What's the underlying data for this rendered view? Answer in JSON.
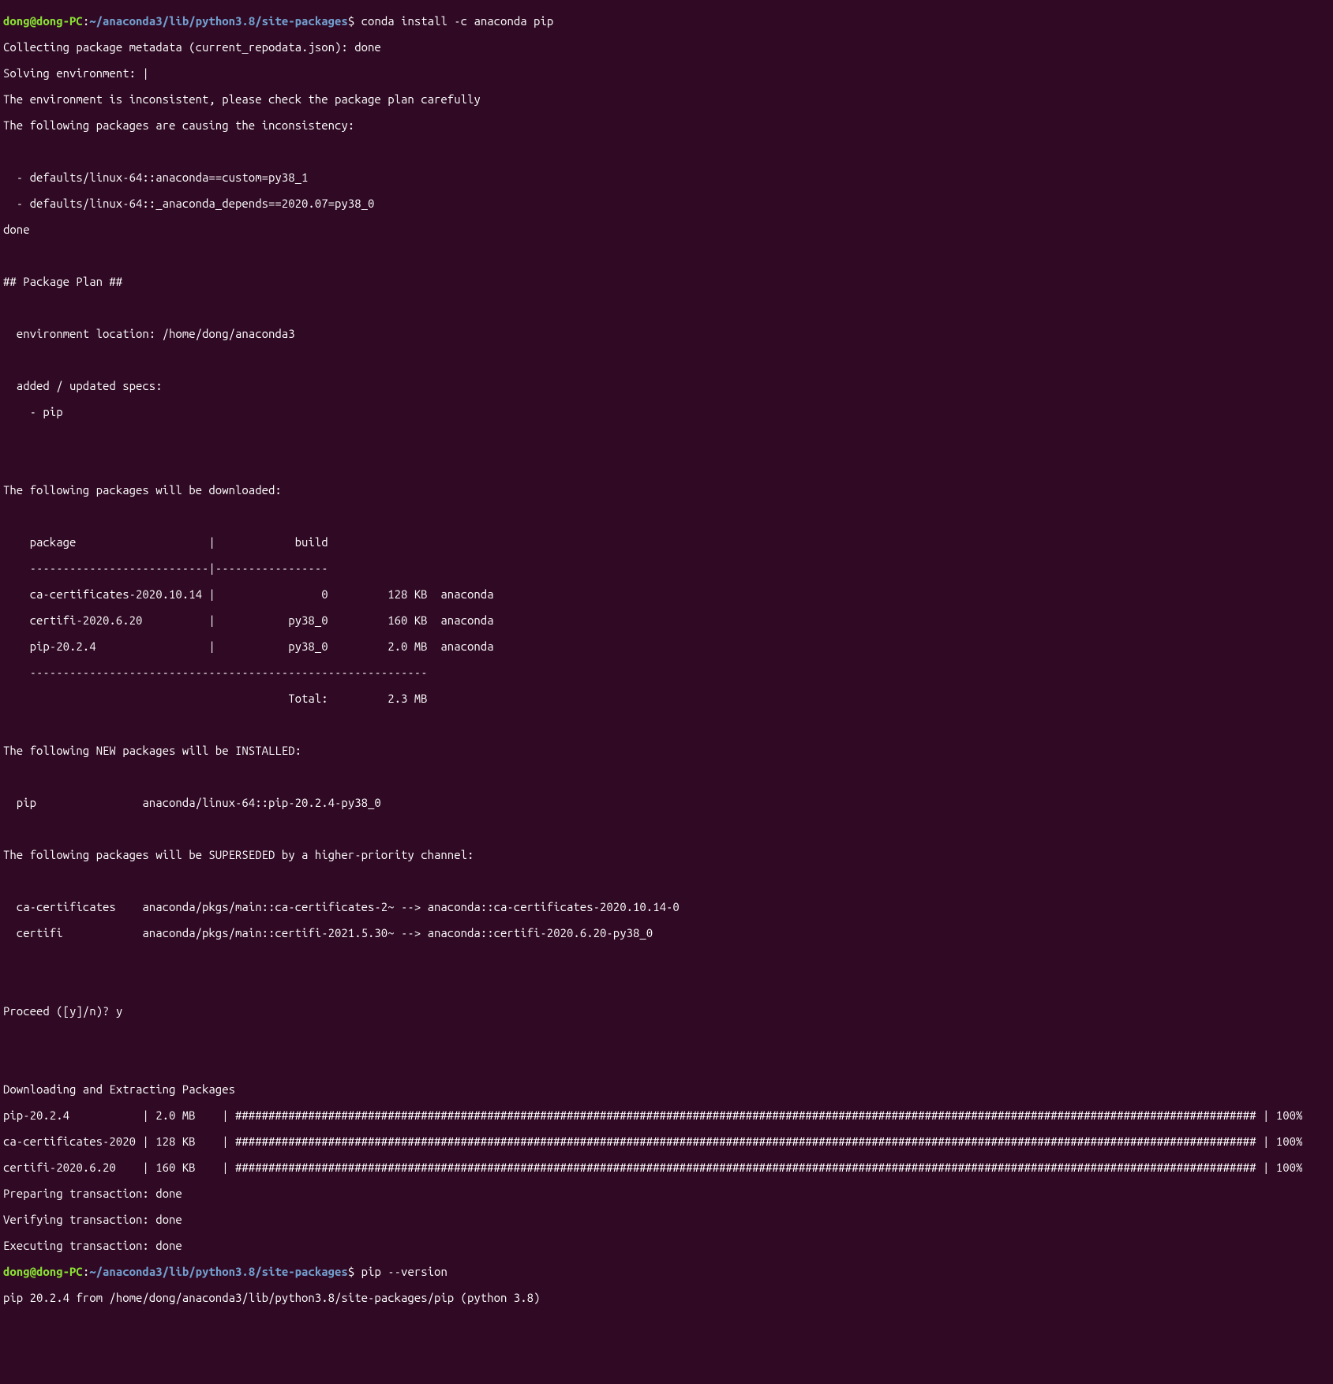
{
  "prompt1": {
    "user": "dong@dong-PC",
    "path": "~/anaconda3/lib/python3.8/site-packages",
    "command": "conda install -c anaconda pip"
  },
  "prompt2": {
    "user": "dong@dong-PC",
    "path": "~/anaconda3/lib/python3.8/site-packages",
    "command": "pip --version"
  },
  "output": {
    "collecting": "Collecting package metadata (current_repodata.json): done",
    "solving": "Solving environment: |",
    "inconsistent": "The environment is inconsistent, please check the package plan carefully",
    "causing": "The following packages are causing the inconsistency:",
    "inc1": "  - defaults/linux-64::anaconda==custom=py38_1",
    "inc2": "  - defaults/linux-64::_anaconda_depends==2020.07=py38_0",
    "done": "done",
    "planHeader": "## Package Plan ##",
    "envLoc": "  environment location: /home/dong/anaconda3",
    "addedSpecs": "  added / updated specs:",
    "specPip": "    - pip",
    "willDownload": "The following packages will be downloaded:",
    "tableHeader": "    package                    |            build",
    "tableDiv1": "    ---------------------------|-----------------",
    "tableRow1": "    ca-certificates-2020.10.14 |                0         128 KB  anaconda",
    "tableRow2": "    certifi-2020.6.20          |           py38_0         160 KB  anaconda",
    "tableRow3": "    pip-20.2.4                 |           py38_0         2.0 MB  anaconda",
    "tableDiv2": "    ------------------------------------------------------------",
    "tableTotal": "                                           Total:         2.3 MB",
    "newInstalled": "The following NEW packages will be INSTALLED:",
    "newPip": "  pip                anaconda/linux-64::pip-20.2.4-py38_0",
    "superseded": "The following packages will be SUPERSEDED by a higher-priority channel:",
    "sup1": "  ca-certificates    anaconda/pkgs/main::ca-certificates-2~ --> anaconda::ca-certificates-2020.10.14-0",
    "sup2": "  certifi            anaconda/pkgs/main::certifi-2021.5.30~ --> anaconda::certifi-2020.6.20-py38_0",
    "proceed": "Proceed ([y]/n)?",
    "proceedAns": "y",
    "downloadHeader": "Downloading and Extracting Packages",
    "prog1": "pip-20.2.4           | 2.0 MB    | ########################################################################################################################################################## | 100%",
    "prog2": "ca-certificates-2020 | 128 KB    | ########################################################################################################################################################## | 100%",
    "prog3": "certifi-2020.6.20    | 160 KB    | ########################################################################################################################################################## | 100%",
    "preparing": "Preparing transaction: done",
    "verifying": "Verifying transaction: done",
    "executing": "Executing transaction: done",
    "pipVersion": "pip 20.2.4 from /home/dong/anaconda3/lib/python3.8/site-packages/pip (python 3.8)"
  }
}
